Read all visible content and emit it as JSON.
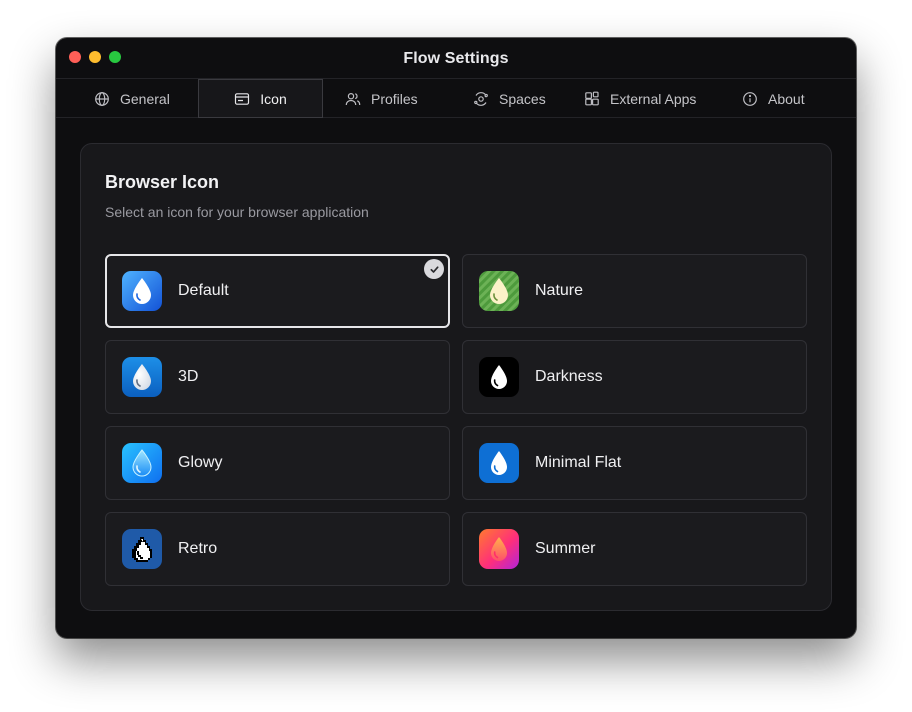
{
  "window": {
    "title": "Flow Settings",
    "traffic_lights": {
      "close": "#ff5f57",
      "minimize": "#febc2e",
      "zoom": "#28c840"
    }
  },
  "tabs": [
    {
      "label": "General",
      "icon": "globe-icon",
      "active": false
    },
    {
      "label": "Icon",
      "icon": "window-icon",
      "active": true
    },
    {
      "label": "Profiles",
      "icon": "users-icon",
      "active": false
    },
    {
      "label": "Spaces",
      "icon": "orbit-icon",
      "active": false
    },
    {
      "label": "External Apps",
      "icon": "blocks-icon",
      "active": false
    },
    {
      "label": "About",
      "icon": "info-icon",
      "active": false
    }
  ],
  "panel": {
    "title": "Browser Icon",
    "subtitle": "Select an icon for your browser application"
  },
  "icons": [
    {
      "label": "Default",
      "selected": true,
      "icon": "drop-default-icon"
    },
    {
      "label": "Nature",
      "selected": false,
      "icon": "drop-nature-icon"
    },
    {
      "label": "3D",
      "selected": false,
      "icon": "drop-3d-icon"
    },
    {
      "label": "Darkness",
      "selected": false,
      "icon": "drop-darkness-icon"
    },
    {
      "label": "Glowy",
      "selected": false,
      "icon": "drop-glowy-icon"
    },
    {
      "label": "Minimal Flat",
      "selected": false,
      "icon": "drop-minimal-flat-icon"
    },
    {
      "label": "Retro",
      "selected": false,
      "icon": "drop-retro-icon"
    },
    {
      "label": "Summer",
      "selected": false,
      "icon": "drop-summer-icon"
    }
  ],
  "colors": {
    "background": "#0e0e10",
    "panel": "#18181b",
    "selected_border": "#e6e6e9"
  }
}
